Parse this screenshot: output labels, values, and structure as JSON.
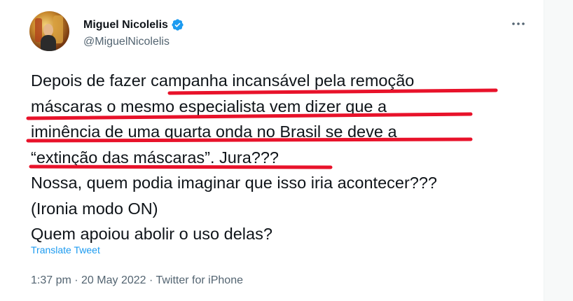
{
  "author": {
    "display_name": "Miguel Nicolelis",
    "handle": "@MiguelNicolelis",
    "verified": true
  },
  "tweet": {
    "lines": [
      "Depois de fazer campanha incansável pela remoção",
      "máscaras o mesmo especialista vem dizer que a",
      "iminência de uma quarta onda no Brasil se deve a",
      "“extinção das máscaras”. Jura???",
      "Nossa, quem podia imaginar que isso iria acontecer???",
      "(Ironia modo ON)",
      "Quem apoiou abolir o uso delas?"
    ],
    "translate_label": "Translate Tweet",
    "time": "1:37 pm",
    "date": "20 May 2022",
    "separator": " · ",
    "source": "Twitter for iPhone"
  },
  "colors": {
    "text": "#0f1419",
    "secondary": "#536471",
    "link": "#1d9bf0",
    "verified": "#1d9bf0",
    "annotation_underline": "#e8122a"
  },
  "icons": {
    "verified": "verified-badge-icon",
    "more": "more-options-icon",
    "avatar": "profile-photo"
  }
}
